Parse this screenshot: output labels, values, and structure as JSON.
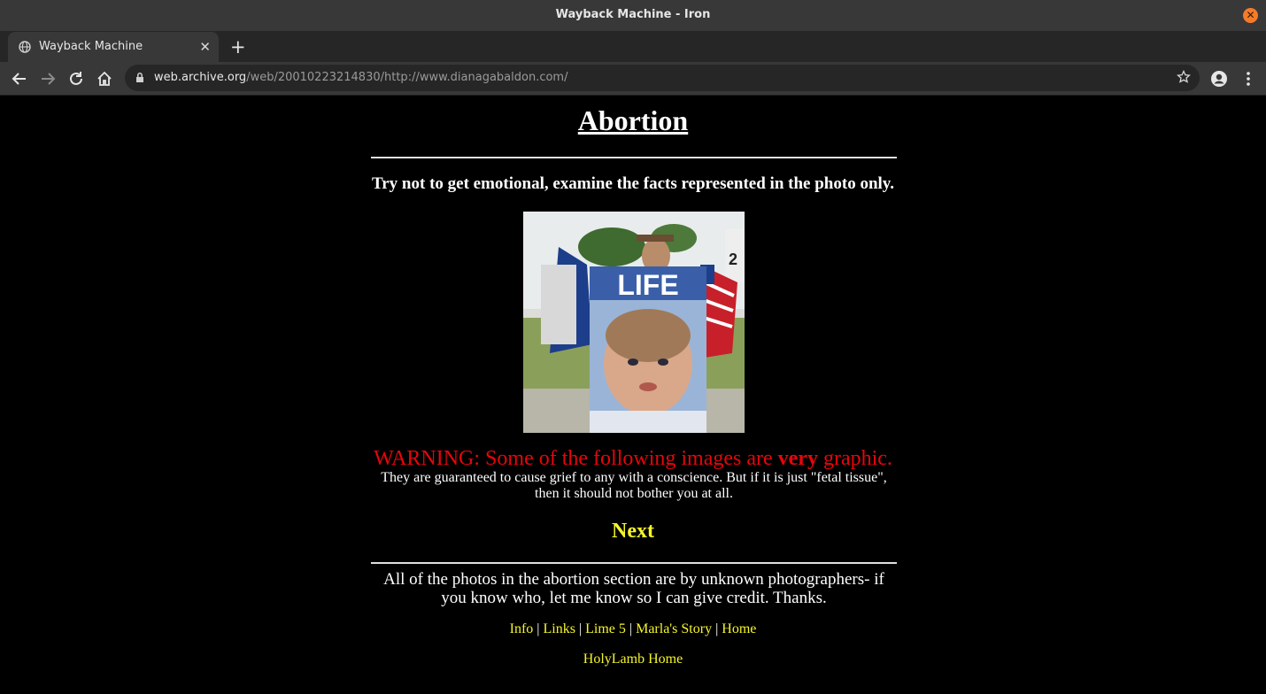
{
  "window": {
    "title": "Wayback Machine - Iron"
  },
  "tab": {
    "label": "Wayback Machine",
    "close": "✕"
  },
  "toolbar": {
    "new_tab": "+"
  },
  "address": {
    "host": "web.archive.org",
    "path": "/web/20010223214830/http://www.dianagabaldon.com/"
  },
  "page": {
    "title": "Abortion",
    "intro": "Try not to get emotional, examine the facts represented in the photo only.",
    "photo": {
      "caption_text": "LIFE"
    },
    "warning": {
      "before": "WARNING: Some of the following images are ",
      "emph": "very",
      "after": " graphic."
    },
    "subtext": "They are guaranteed to cause grief to any with a conscience. But if it is just \"fetal tissue\", then it should not bother you at all.",
    "next_link": "Next",
    "credit": "All of the photos in the abortion section are by unknown photographers- if you know who, let me know so I can give credit. Thanks.",
    "nav": {
      "separator": "|",
      "info": "Info",
      "links": "Links",
      "lime5": "Lime 5",
      "marlas_story": "Marla's Story",
      "home": "Home"
    },
    "holylamb_home": "HolyLamb Home"
  },
  "colors": {
    "warning": "#e8050b",
    "link": "#f5f52a",
    "page_bg": "#000000"
  }
}
